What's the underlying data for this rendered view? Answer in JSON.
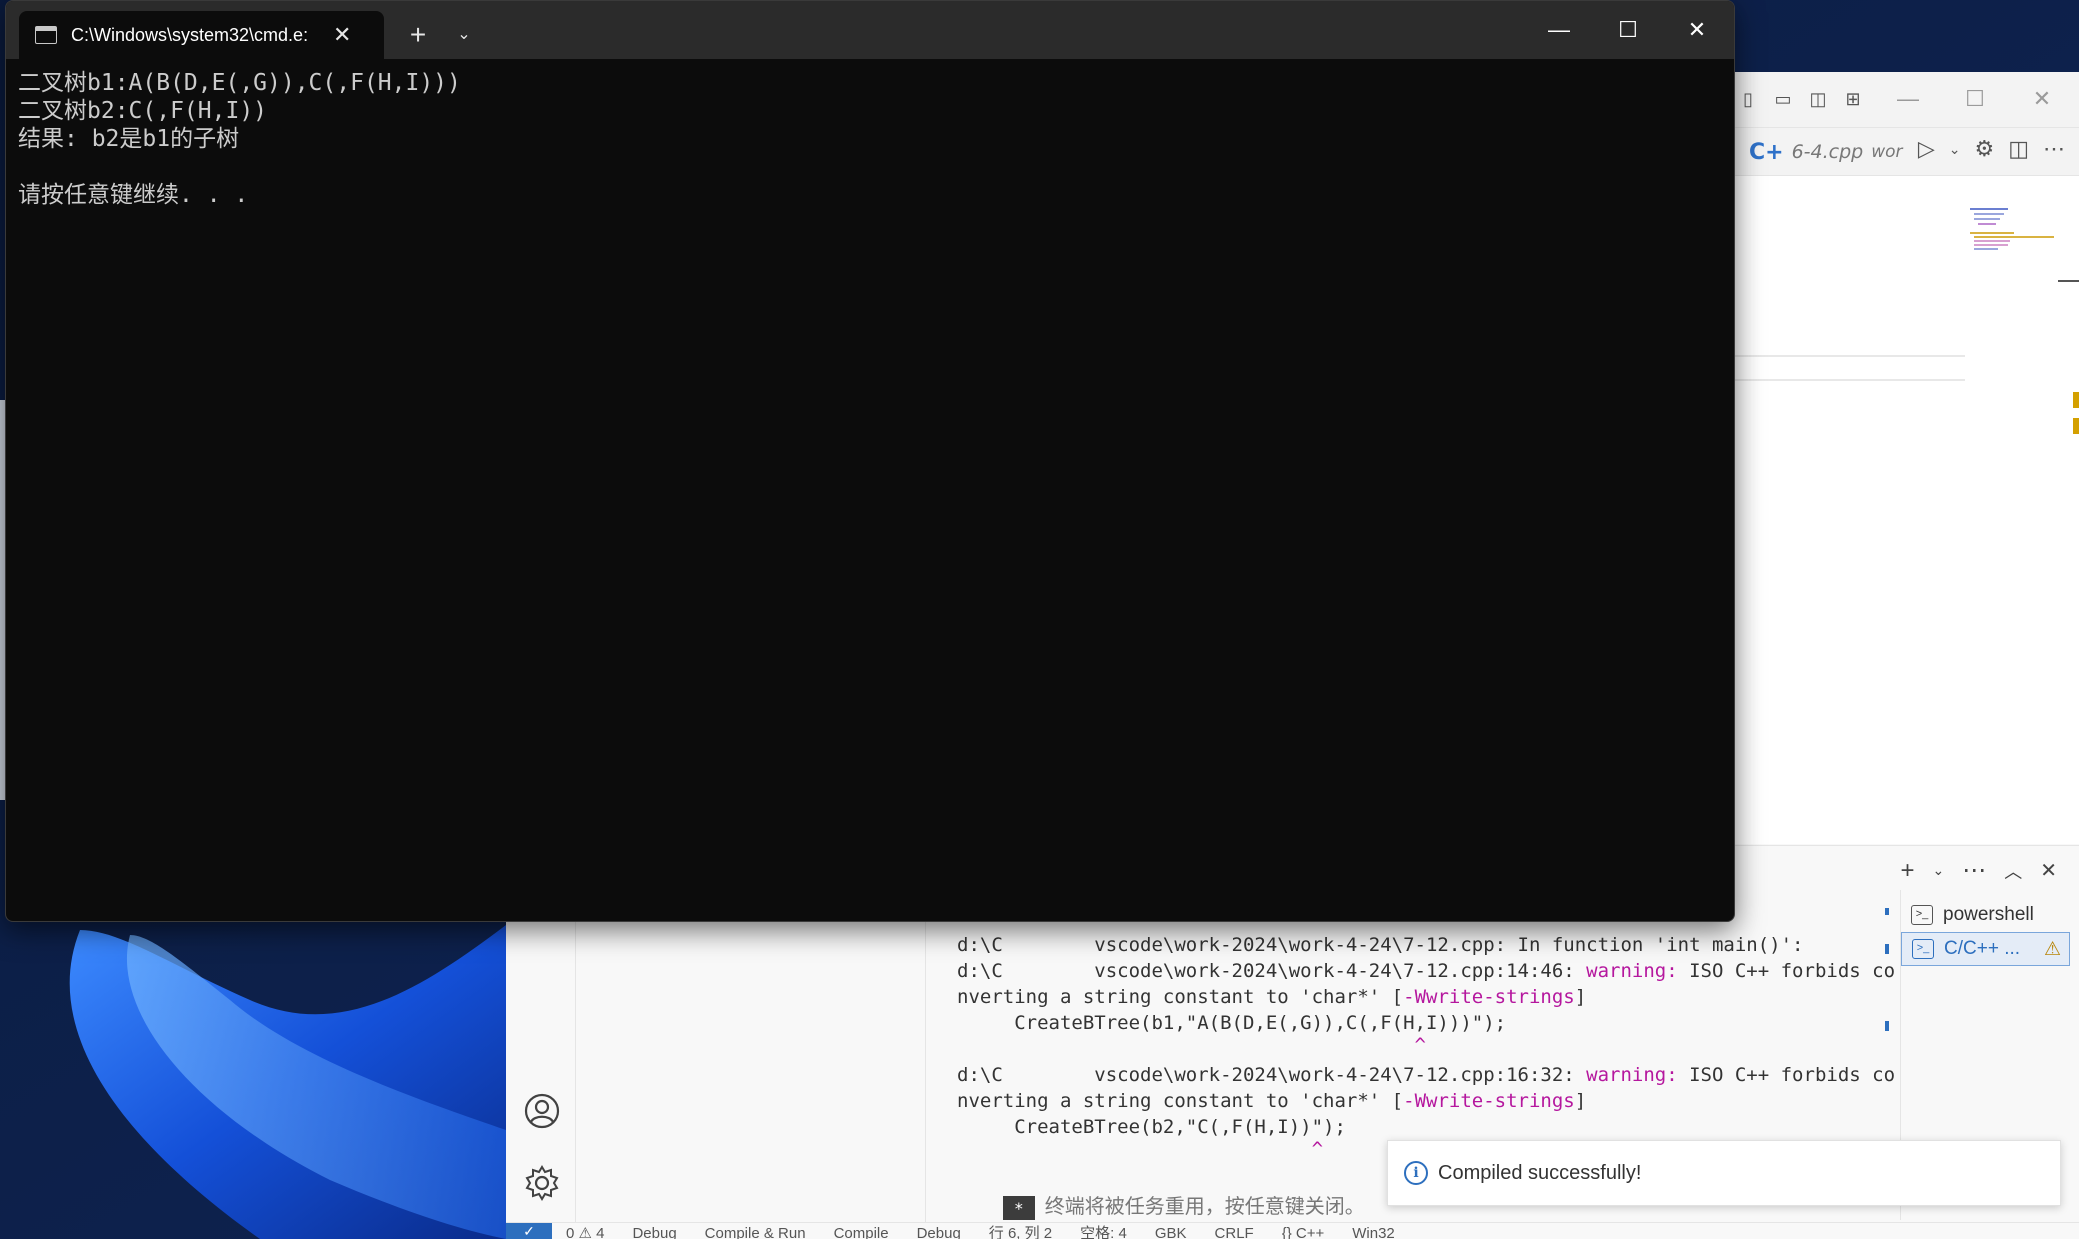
{
  "cmd": {
    "tab_title": "C:\\Windows\\system32\\cmd.e:",
    "new_tab_label": "+",
    "lines": [
      "二叉树b1:A(B(D,E(,G)),C(,F(H,I)))",
      "二叉树b2:C(,F(H,I))",
      "结果: b2是b1的子树",
      "",
      "请按任意键继续. . ."
    ]
  },
  "vscode": {
    "active_tab": "6-4.cpp",
    "active_tab_suffix": "wor",
    "terminal_list": [
      {
        "label": "powershell",
        "active": false
      },
      {
        "label": "C/C++ ...",
        "active": true
      }
    ],
    "terminal_output": [
      {
        "text": "d:\\C        vscode\\work-2024\\work-4-24\\7-12.cpp: In function 'int main()':"
      },
      {
        "prefix": "d:\\C        vscode\\work-2024\\work-4-24\\7-12.cpp:14:46: ",
        "warn": "warning:",
        "rest": " ISO C++ forbids co"
      },
      {
        "prefix": "nverting a string constant to 'char*' [",
        "flag": "-Wwrite-strings",
        "rest": "]"
      },
      {
        "text": "     CreateBTree(b1,\"A(B(D,E(,G)),C(,F(H,I)))\");"
      },
      {
        "caret": "                                        ^"
      },
      {
        "prefix": "d:\\C        vscode\\work-2024\\work-4-24\\7-12.cpp:16:32: ",
        "warn": "warning:",
        "rest": " ISO C++ forbids co"
      },
      {
        "prefix": "nverting a string constant to 'char*' [",
        "flag": "-Wwrite-strings",
        "rest": "]"
      },
      {
        "text": "     CreateBTree(b2,\"C(,F(H,I))\");"
      },
      {
        "caret": "                               ^"
      }
    ],
    "terminal_badge": "*",
    "terminal_reuse_msg": "终端将被任务重用，按任意键关闭。",
    "toast_message": "Compiled successfully!",
    "status_items": [
      "0 ⚠ 4",
      "Debug",
      "Compile & Run",
      "Compile",
      "Debug",
      "行 6, 列 2",
      "空格: 4",
      "GBK",
      "CRLF",
      "{} C++",
      "Win32"
    ],
    "colors": {
      "accent": "#2d6fbe",
      "warning": "#b5179e"
    }
  }
}
